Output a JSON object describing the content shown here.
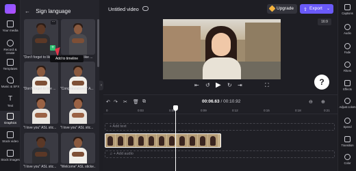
{
  "left_rail": {
    "items": [
      {
        "label": "Your media",
        "icon": "folder-icon"
      },
      {
        "label": "Record & create",
        "icon": "record-icon"
      },
      {
        "label": "Templates",
        "icon": "templates-icon"
      },
      {
        "label": "Music & SFX",
        "icon": "music-icon"
      },
      {
        "label": "Text",
        "icon": "text-icon"
      },
      {
        "label": "Graphics",
        "icon": "graphics-icon"
      },
      {
        "label": "Stock video",
        "icon": "stock-video-icon"
      },
      {
        "label": "Stock images",
        "icon": "stock-images-icon"
      }
    ],
    "active": "Graphics"
  },
  "panel": {
    "title": "Sign language",
    "tooltip": "Add to timeline",
    "add_symbol": "+",
    "more_symbol": "···",
    "tiles": [
      {
        "caption": "\"Don't forget to like ..."
      },
      {
        "caption": "\"Don't forget to like ..."
      },
      {
        "caption": "\"Don't forget to like ..."
      },
      {
        "caption": "\"Congratulations!\" A..."
      },
      {
        "caption": "\"I love you\" ASL stic..."
      },
      {
        "caption": "\"I love you\" ASL stic..."
      },
      {
        "caption": "\"I love you\" ASL stic..."
      },
      {
        "caption": "\"Welcome\" ASL sticke..."
      }
    ]
  },
  "topbar": {
    "title": "Untitled video",
    "upgrade_label": "Upgrade",
    "export_label": "Export",
    "ratio": "16:9"
  },
  "playback": {
    "prev": "⇤",
    "back5": "↺",
    "play": "▶",
    "fwd5": "↻",
    "next": "⇥",
    "fullscreen": "⛶",
    "help": "?"
  },
  "right_rail": {
    "items": [
      {
        "label": "Captions",
        "icon": "captions-icon"
      },
      {
        "label": "Audio",
        "icon": "audio-icon"
      },
      {
        "label": "Fade",
        "icon": "fade-icon"
      },
      {
        "label": "Filters",
        "icon": "filters-icon"
      },
      {
        "label": "Effects",
        "icon": "effects-icon"
      },
      {
        "label": "Adjust colors",
        "icon": "adjust-colors-icon"
      },
      {
        "label": "Speed",
        "icon": "speed-icon"
      },
      {
        "label": "Transition",
        "icon": "transition-icon"
      },
      {
        "label": "Color",
        "icon": "color-icon"
      }
    ]
  },
  "timeline": {
    "current_time": "00:06.63",
    "total_time": "00:10.92",
    "separator": "/",
    "ticks": [
      "0",
      "0:03",
      "0:06",
      "0:09",
      "0:12",
      "0:15",
      "0:18",
      "0:21"
    ],
    "add_text": "+ Add text",
    "add_audio": "+ Add audio",
    "tools": {
      "undo": "↶",
      "redo": "↷",
      "cut": "✂",
      "delete": "🗑",
      "duplicate": "⧉",
      "zoom_out": "⊖",
      "zoom_in": "⊕"
    }
  },
  "colors": {
    "accent": "#6a5af9",
    "add_green": "#2fbf72",
    "upgrade_gem": "#f3b23e"
  }
}
